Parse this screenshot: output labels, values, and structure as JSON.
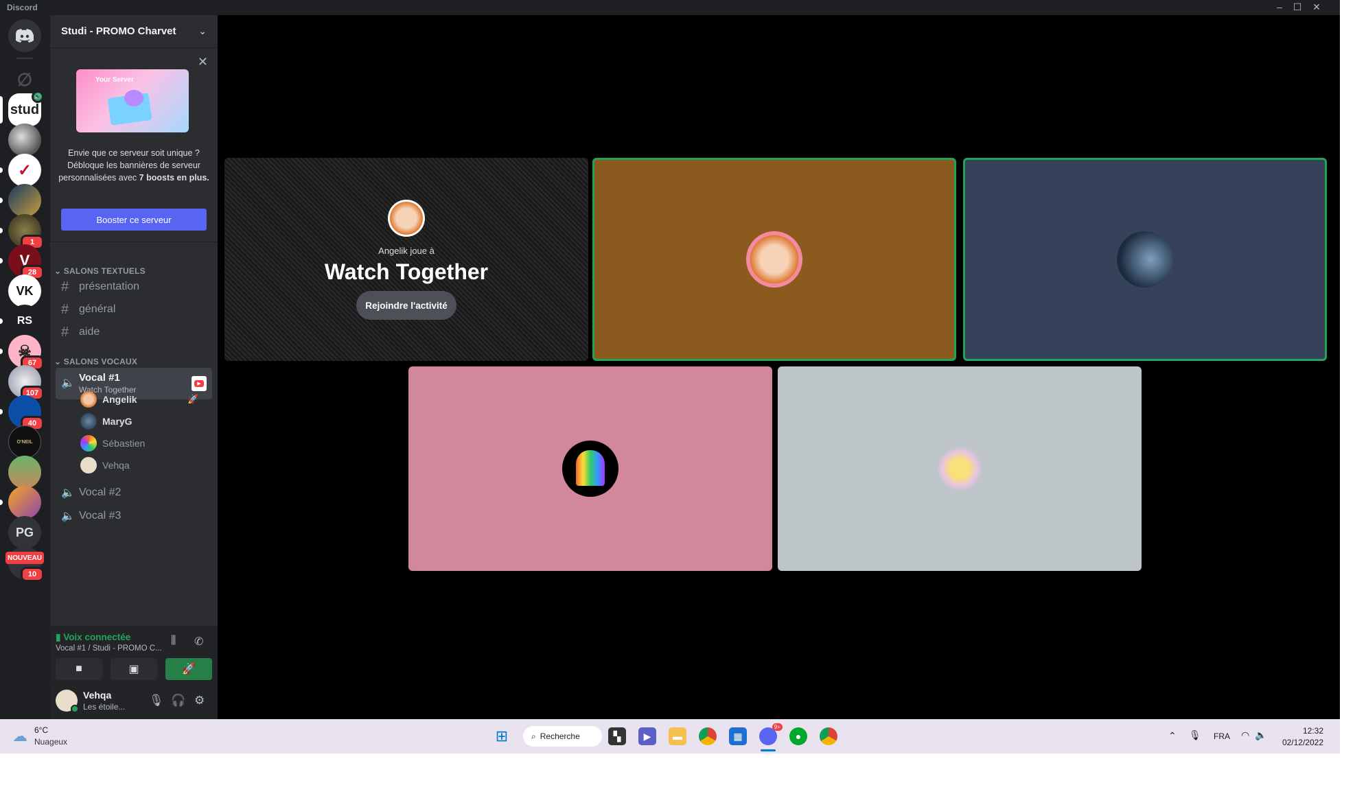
{
  "window": {
    "title": "Discord"
  },
  "server": {
    "name": "Studi - PROMO Charvet"
  },
  "rail": {
    "servers": [
      {
        "label": "",
        "badge": ""
      },
      {
        "label": "stud",
        "badge": ""
      },
      {
        "label": "",
        "badge": ""
      },
      {
        "label": "",
        "badge": ""
      },
      {
        "label": "",
        "badge": ""
      },
      {
        "label": "",
        "badge": "1"
      },
      {
        "label": "",
        "badge": "28"
      },
      {
        "label": "VK",
        "badge": ""
      },
      {
        "label": "RS",
        "badge": ""
      },
      {
        "label": "",
        "badge": "67"
      },
      {
        "label": "",
        "badge": "107"
      },
      {
        "label": "",
        "badge": "40"
      },
      {
        "label": "O'NEIL",
        "badge": ""
      },
      {
        "label": "",
        "badge": ""
      },
      {
        "label": "",
        "badge": ""
      },
      {
        "label": "PG",
        "badge": ""
      },
      {
        "label": "NOUVEAU",
        "badge": "10"
      }
    ]
  },
  "promo": {
    "art_title": "Your Server",
    "text_part1": "Envie que ce serveur soit unique ? Débloque les bannières de serveur personnalisées avec ",
    "text_bold": "7 boosts en plus.",
    "button": "Booster ce serveur"
  },
  "text_category": "SALONS TEXTUELS",
  "text_channels": [
    "présentation",
    "général",
    "aide"
  ],
  "voice_category": "SALONS VOCAUX",
  "voice_channels": [
    {
      "name": "Vocal #1",
      "activity": "Watch Together"
    },
    {
      "name": "Vocal #2"
    },
    {
      "name": "Vocal #3"
    }
  ],
  "members": [
    "Angelik",
    "MaryG",
    "Sébastien",
    "Vehqa"
  ],
  "voice_panel": {
    "status": "Voix connectée",
    "location": "Vocal #1 / Studi - PROMO C..."
  },
  "user": {
    "name": "Vehqa",
    "status": "Les étoile..."
  },
  "stage": {
    "activity_host": "Angelik joue à",
    "activity_name": "Watch Together",
    "join_button": "Rejoindre l'activité",
    "tile_colors": [
      "#8a5a1f",
      "#36425a",
      "#d1889a",
      "#bec5c9"
    ]
  },
  "taskbar": {
    "temperature": "6°C",
    "condition": "Nuageux",
    "search": "Recherche",
    "language": "FRA",
    "time": "12:32",
    "date": "02/12/2022",
    "discord_badge": "9+"
  }
}
